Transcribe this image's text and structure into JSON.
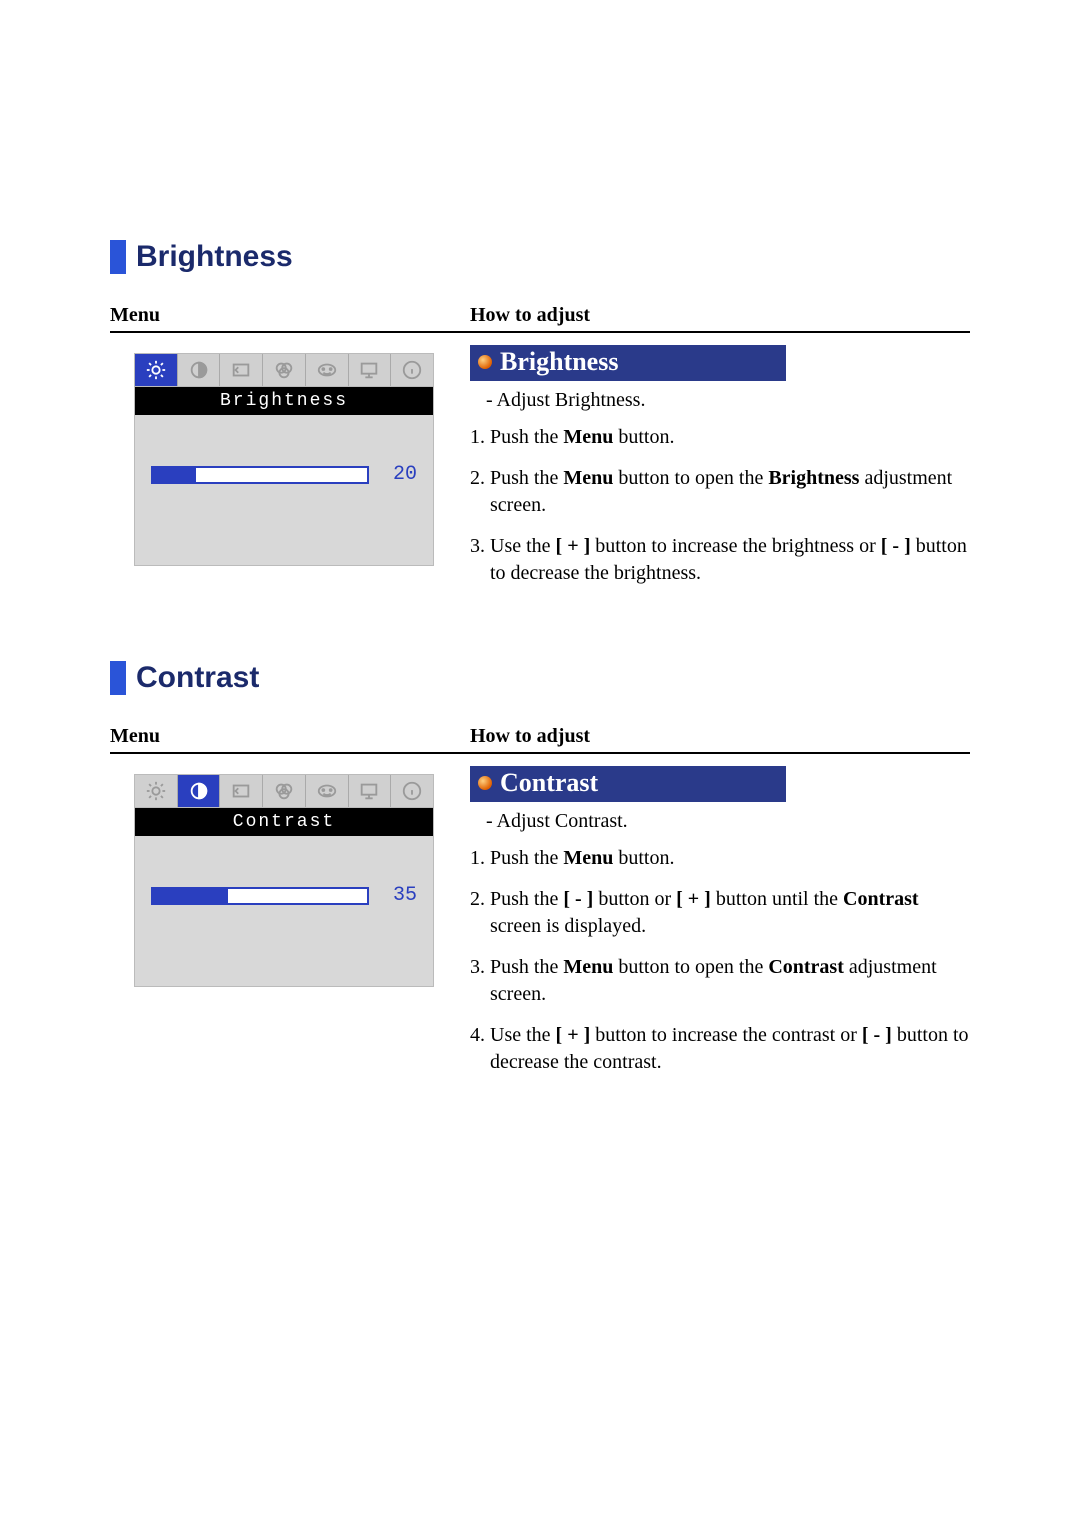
{
  "headers": {
    "menu": "Menu",
    "howto": "How to adjust"
  },
  "brightness": {
    "title": "Brightness",
    "osd_label": "Brightness",
    "osd_value": "20",
    "osd_fill_pct": "20%",
    "active_icon_index": 0,
    "sub_heading": "Brightness",
    "desc": "-  Adjust Brightness.",
    "steps": [
      "1. Push the <b>Menu</b> button.",
      "2. Push the <b>Menu</b>  button to open the <b>Brightness</b> adjustment screen.",
      "3. Use the <b>[ + ]</b>  button to increase the brightness or <b>[ - ]</b>  button to decrease the brightness."
    ]
  },
  "contrast": {
    "title": "Contrast",
    "osd_label": "Contrast",
    "osd_value": "35",
    "osd_fill_pct": "35%",
    "active_icon_index": 1,
    "sub_heading": "Contrast",
    "desc": "-  Adjust Contrast.",
    "steps": [
      "1. Push the <b>Menu</b> button.",
      "2. Push the <b>[ - ]</b> button or <b>[ + ]</b>  button until the <b>Contrast</b> screen is displayed.",
      "3. Push the <b>Menu</b>  button to open the <b>Contrast</b> adjustment screen.",
      "4. Use the <b>[ + ]</b>  button to increase the contrast  or <b>[ - ]</b> button to decrease the contrast."
    ]
  },
  "osd_icons": [
    "brightness-icon",
    "contrast-icon",
    "position-icon",
    "color-icon",
    "language-icon",
    "display-icon",
    "info-icon"
  ]
}
